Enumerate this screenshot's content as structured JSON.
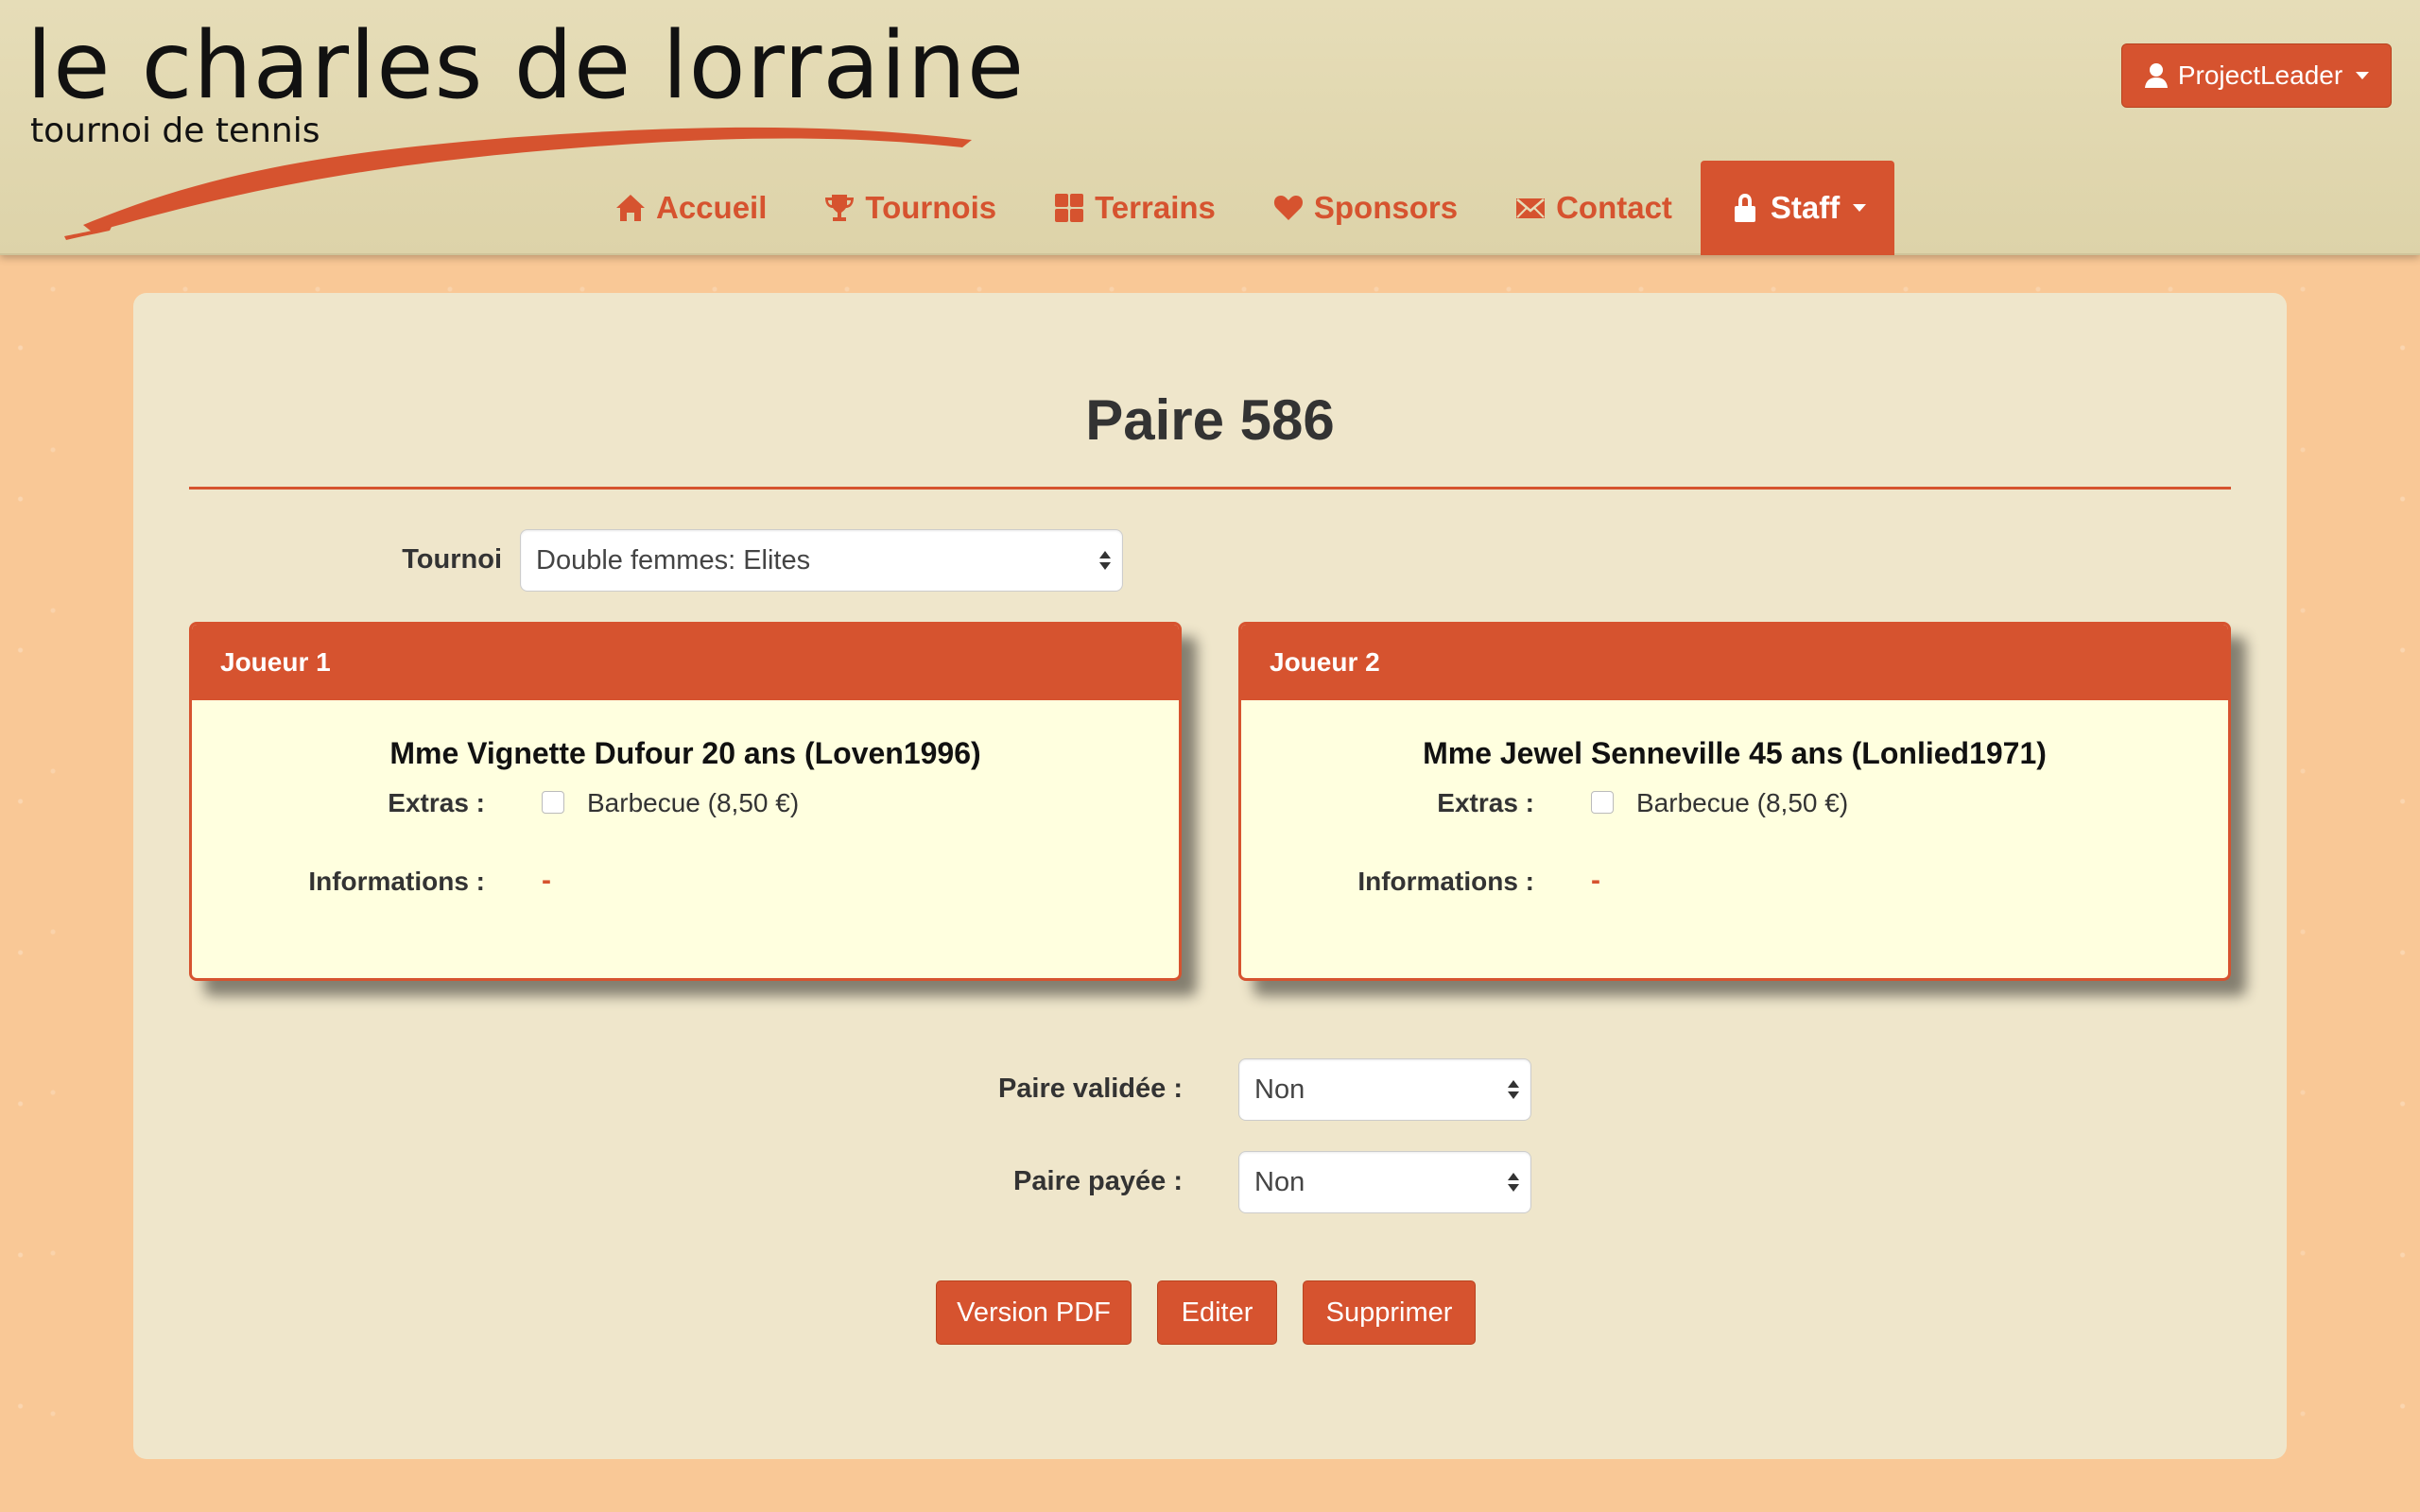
{
  "brand": {
    "title": "le charles de lorraine",
    "subtitle": "tournoi de tennis",
    "accent_color": "#d6532f"
  },
  "user_menu": {
    "label": "ProjectLeader",
    "icon": "user-icon"
  },
  "nav": [
    {
      "label": "Accueil",
      "icon": "home-icon"
    },
    {
      "label": "Tournois",
      "icon": "trophy-icon"
    },
    {
      "label": "Terrains",
      "icon": "grid-icon"
    },
    {
      "label": "Sponsors",
      "icon": "heart-icon"
    },
    {
      "label": "Contact",
      "icon": "envelope-icon"
    },
    {
      "label": "Staff",
      "icon": "lock-icon",
      "active": true
    }
  ],
  "page": {
    "title": "Paire 586",
    "tournoi_label": "Tournoi",
    "tournoi_value": "Double femmes: Elites"
  },
  "players": [
    {
      "header": "Joueur 1",
      "name": "Mme Vignette Dufour 20 ans (Loven1996)",
      "extras_label": "Extras :",
      "extra_item": "Barbecue (8,50 €)",
      "extra_checked": false,
      "info_label": "Informations :",
      "info_value": "-"
    },
    {
      "header": "Joueur 2",
      "name": "Mme Jewel Senneville 45 ans (Lonlied1971)",
      "extras_label": "Extras :",
      "extra_item": "Barbecue (8,50 €)",
      "extra_checked": false,
      "info_label": "Informations :",
      "info_value": "-"
    }
  ],
  "status": {
    "validated_label": "Paire validée :",
    "validated_value": "Non",
    "paid_label": "Paire payée :",
    "paid_value": "Non"
  },
  "actions": {
    "pdf": "Version PDF",
    "edit": "Editer",
    "delete": "Supprimer"
  }
}
